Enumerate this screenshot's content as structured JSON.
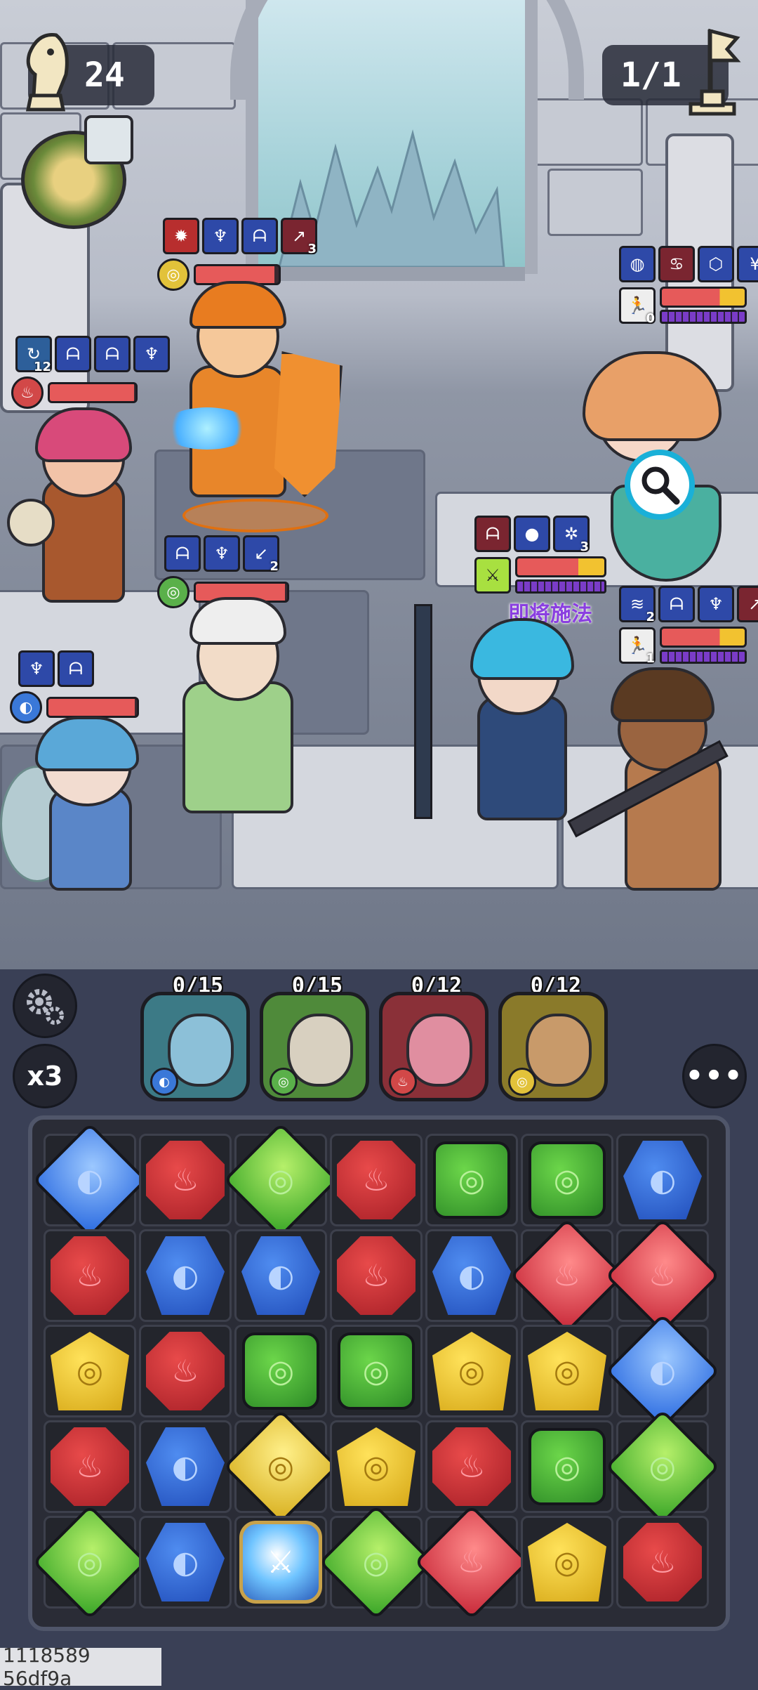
{
  "hud": {
    "moves_left": "24",
    "wave": "1/1",
    "moves_icon": "knight-chess-icon",
    "wave_icon": "flag-icon"
  },
  "allies": [
    {
      "id": "warrior",
      "element": "yellow",
      "hp": 0.95,
      "buffs": [
        {
          "color": "red",
          "icon": "fire"
        },
        {
          "color": "blue",
          "icon": "spirit"
        },
        {
          "color": "blue",
          "icon": "claw"
        },
        {
          "color": "maroon",
          "icon": "strike",
          "count": "3"
        }
      ]
    },
    {
      "id": "engineer",
      "element": "red",
      "hp": 0.98,
      "buffs": [
        {
          "color": "cyan",
          "icon": "cycle",
          "count": "12"
        },
        {
          "color": "blue",
          "icon": "claw"
        },
        {
          "color": "blue",
          "icon": "claw"
        },
        {
          "color": "blue",
          "icon": "spirit"
        }
      ]
    },
    {
      "id": "sage",
      "element": "green",
      "hp": 0.98,
      "buffs": [
        {
          "color": "blue",
          "icon": "claw"
        },
        {
          "color": "blue",
          "icon": "spirit"
        },
        {
          "color": "blue",
          "icon": "blade",
          "count": "2"
        }
      ]
    },
    {
      "id": "fairy",
      "element": "blue",
      "hp": 0.98,
      "buffs": [
        {
          "color": "blue",
          "icon": "spirit"
        },
        {
          "color": "blue",
          "icon": "claw"
        }
      ]
    }
  ],
  "enemies": [
    {
      "id": "mermaid",
      "hp": 0.75,
      "mana_count": "0",
      "buffs": [
        {
          "color": "blue",
          "icon": "helm"
        },
        {
          "color": "maroon",
          "icon": "crab"
        },
        {
          "color": "blue",
          "icon": "shield"
        },
        {
          "color": "blue",
          "icon": "wing"
        }
      ]
    },
    {
      "id": "antler-mage",
      "hp": 0.75,
      "status": "即将施法",
      "buffs": [
        {
          "color": "maroon",
          "icon": "claw"
        },
        {
          "color": "blue",
          "icon": "drop"
        },
        {
          "color": "blue",
          "icon": "gear",
          "count": "3"
        }
      ]
    },
    {
      "id": "barbarian",
      "hp": 0.75,
      "mana_count": "1",
      "buffs": [
        {
          "color": "blue",
          "icon": "swirl",
          "count": "2"
        },
        {
          "color": "blue",
          "icon": "claw"
        },
        {
          "color": "blue",
          "icon": "spirit"
        },
        {
          "color": "maroon",
          "icon": "strike"
        }
      ]
    }
  ],
  "team": [
    {
      "counter": "0/15",
      "element": "blue",
      "frame": "#3c7a86",
      "face": "#8cc0d8"
    },
    {
      "counter": "0/15",
      "element": "green",
      "frame": "#4f8a3a",
      "face": "#d8d0c0"
    },
    {
      "counter": "0/12",
      "element": "red",
      "frame": "#8a3038",
      "face": "#e08ea0"
    },
    {
      "counter": "0/12",
      "element": "yellow",
      "frame": "#8a7a2a",
      "face": "#c89a6a"
    }
  ],
  "controls": {
    "speed": "x3",
    "settings_icon": "gears-icon",
    "more_icon": "ellipsis-icon",
    "inspect_icon": "magnifier-icon"
  },
  "board": [
    [
      "blue*",
      "red",
      "green*",
      "red",
      "green",
      "green",
      "blue"
    ],
    [
      "red",
      "blue",
      "blue",
      "red",
      "blue",
      "red*",
      "red*"
    ],
    [
      "yellow",
      "red",
      "green",
      "green",
      "yellow",
      "yellow",
      "blue*"
    ],
    [
      "red",
      "blue",
      "yellow*",
      "yellow",
      "red",
      "green",
      "green*"
    ],
    [
      "green*",
      "blue",
      "sword",
      "green*",
      "red*",
      "yellow",
      "red"
    ]
  ],
  "debug_id": "1118589 56df9a"
}
